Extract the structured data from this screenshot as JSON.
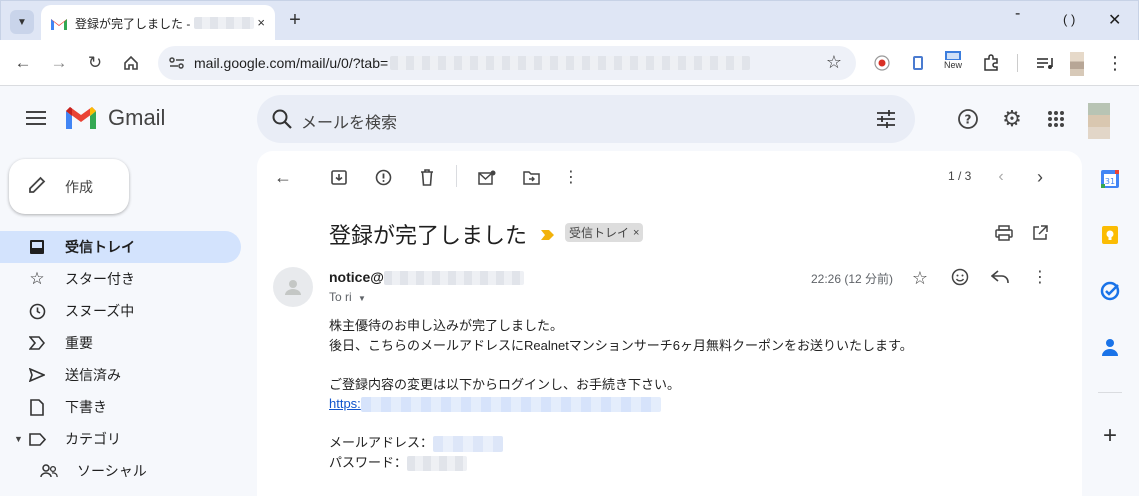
{
  "browser": {
    "tab_title": "登録が完了しました -",
    "tab_close": "×",
    "new_tab": "+",
    "url": "mail.google.com/mail/u/0/?tab=",
    "ext_new_badge": "New"
  },
  "gmail": {
    "brand": "Gmail",
    "search_placeholder": "メールを検索",
    "compose_label": "作成"
  },
  "sidebar": {
    "items": [
      {
        "label": "受信トレイ",
        "icon": "inbox-icon",
        "active": true
      },
      {
        "label": "スター付き",
        "icon": "star-icon"
      },
      {
        "label": "スヌーズ中",
        "icon": "clock-icon"
      },
      {
        "label": "重要",
        "icon": "important-icon"
      },
      {
        "label": "送信済み",
        "icon": "send-icon"
      },
      {
        "label": "下書き",
        "icon": "draft-icon"
      },
      {
        "label": "カテゴリ",
        "icon": "label-icon"
      },
      {
        "label": "ソーシャル",
        "icon": "people-icon"
      }
    ]
  },
  "message": {
    "pager": "1 / 3",
    "subject": "登録が完了しました",
    "label_chip": "受信トレイ",
    "label_chip_close": "×",
    "sender": "notice@",
    "to": "To ri",
    "time": "22:26 (12 分前)",
    "body": {
      "line1": "株主優待のお申し込みが完了しました。",
      "line2": "後日、こちらのメールアドレスにRealnetマンションサーチ6ヶ月無料クーポンをお送りいたします。",
      "line3": "ご登録内容の変更は以下からログインし、お手続き下さい。",
      "link": "https:",
      "line4": "メールアドレス：",
      "line5": "パスワード："
    }
  },
  "colors": {
    "active_nav": "#d3e3fd",
    "link": "#1155cc",
    "important_marker": "#f2b20a"
  }
}
